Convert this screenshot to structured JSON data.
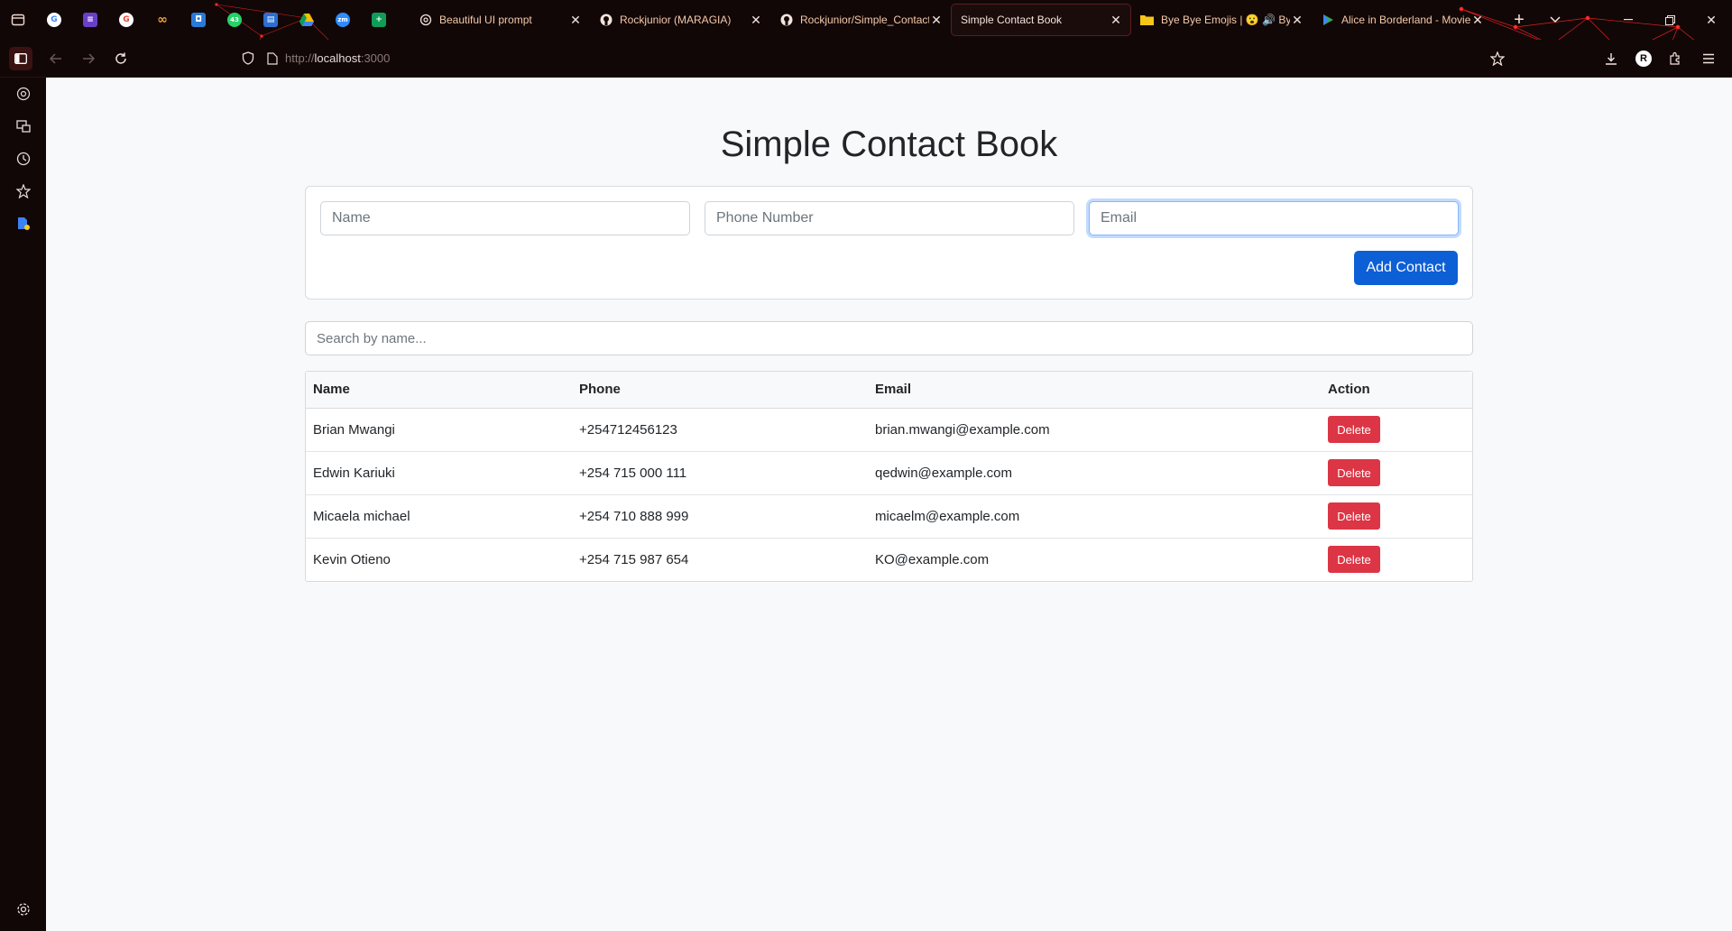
{
  "browser": {
    "tabs": [
      {
        "title": "Beautiful UI prompt",
        "icon": "openai-icon"
      },
      {
        "title": "Rockjunior (MARAGIA)",
        "icon": "github-icon"
      },
      {
        "title": "Rockjunior/Simple_Contact",
        "icon": "github-icon"
      },
      {
        "title": "Simple Contact Book",
        "icon": "",
        "active": true
      },
      {
        "title": "Bye Bye Emojis | 😮 🔊 Bye",
        "icon": "folder-icon"
      },
      {
        "title": "Alice in Borderland - Movie",
        "icon": "play-icon"
      }
    ],
    "pinned_badge": "43",
    "zoom_badge": "zm",
    "url_prefix": "http://",
    "url_host": "localhost",
    "url_port": ":3000",
    "profile_initial": "R"
  },
  "app": {
    "title": "Simple Contact Book",
    "form": {
      "name_placeholder": "Name",
      "phone_placeholder": "Phone Number",
      "email_placeholder": "Email",
      "add_button": "Add Contact"
    },
    "search_placeholder": "Search by name...",
    "table": {
      "headers": [
        "Name",
        "Phone",
        "Email",
        "Action"
      ],
      "rows": [
        {
          "name": "Brian Mwangi",
          "phone": "+254712456123",
          "email": "brian.mwangi@example.com",
          "action": "Delete"
        },
        {
          "name": "Edwin Kariuki",
          "phone": "+254 715 000 111",
          "email": "qedwin@example.com",
          "action": "Delete"
        },
        {
          "name": "Micaela michael",
          "phone": "+254 710 888 999",
          "email": "micaelm@example.com",
          "action": "Delete"
        },
        {
          "name": "Kevin Otieno",
          "phone": "+254 715 987 654",
          "email": "KO@example.com",
          "action": "Delete"
        }
      ]
    }
  },
  "colors": {
    "primary": "#0d5fd6",
    "danger": "#dc3545",
    "browser_bg": "#120707",
    "page_bg": "#f8f9fa"
  }
}
